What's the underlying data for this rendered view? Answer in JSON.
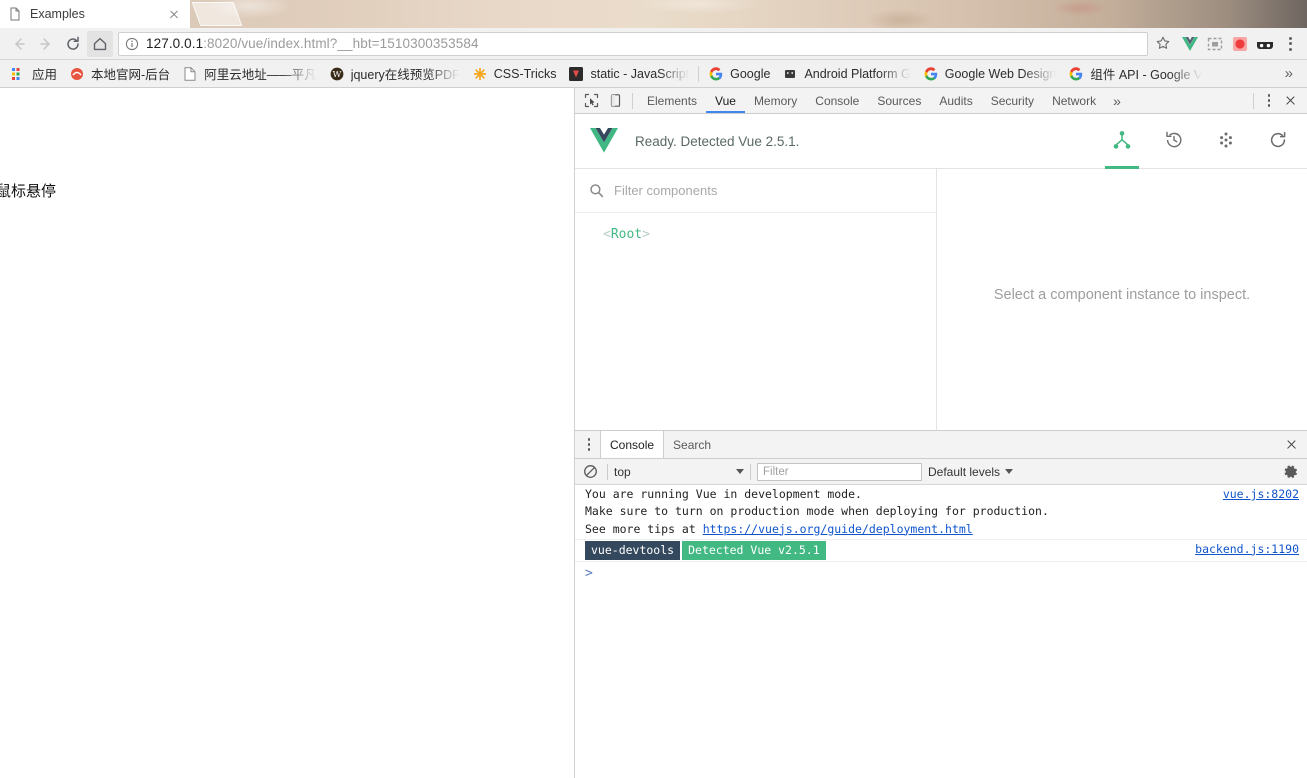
{
  "browser": {
    "tab": {
      "title": "Examples",
      "favicon": "page-icon",
      "close": "close-icon"
    },
    "nav": {
      "back": "back-arrow-icon",
      "forward": "forward-arrow-icon",
      "reload": "reload-icon",
      "home": "home-icon"
    },
    "omnibox": {
      "security_icon": "info-circle-icon",
      "url_host": "127.0.0.1",
      "url_rest": ":8020/vue/index.html?__hbt=1510300353584",
      "url_full": "127.0.0.1:8020/vue/index.html?__hbt=1510300353584",
      "bookmark_star": "star-icon"
    },
    "extensions": [
      {
        "name": "vue-devtools-extension-icon",
        "color": "#41b883"
      },
      {
        "name": "screenshot-extension-icon",
        "color": "#9e9e9e"
      },
      {
        "name": "recorder-extension-icon",
        "color": "#ef4b4b"
      },
      {
        "name": "glasses-extension-icon",
        "color": "#2b2b2b"
      }
    ],
    "menu": "chrome-menu-icon",
    "bookmarks": [
      {
        "label": "应用",
        "icon": "apps-grid-icon"
      },
      {
        "label": "本地官网-后台",
        "icon": "site-favicon"
      },
      {
        "label": "阿里云地址——平凡",
        "icon": "page-icon"
      },
      {
        "label": "jquery在线预览PDF",
        "icon": "wordpress-favicon"
      },
      {
        "label": "CSS-Tricks",
        "icon": "css-tricks-favicon"
      },
      {
        "label": "static - JavaScript",
        "icon": "dark-favicon"
      },
      {
        "label": "Google",
        "icon": "google-favicon"
      },
      {
        "label": "Android Platform G",
        "icon": "android-favicon"
      },
      {
        "label": "Google Web Design",
        "icon": "google-favicon"
      },
      {
        "label": "组件 API - Google V",
        "icon": "google-favicon"
      }
    ],
    "bookmarks_overflow": "»"
  },
  "page": {
    "text": "鼠标悬停"
  },
  "devtools": {
    "inspect_icon": "inspect-element-icon",
    "device_icon": "toggle-device-toolbar-icon",
    "tabs": [
      {
        "label": "Elements",
        "active": false
      },
      {
        "label": "Vue",
        "active": true
      },
      {
        "label": "Memory",
        "active": false
      },
      {
        "label": "Console",
        "active": false
      },
      {
        "label": "Sources",
        "active": false
      },
      {
        "label": "Audits",
        "active": false
      },
      {
        "label": "Security",
        "active": false
      },
      {
        "label": "Network",
        "active": false
      }
    ],
    "more_tabs": "»",
    "settings_menu": "devtools-kebab-icon",
    "close": "close-icon",
    "accent": "#4285f4"
  },
  "vue_panel": {
    "logo": "vue-logo-icon",
    "status": "Ready. Detected Vue 2.5.1.",
    "accent": "#42b883",
    "actions": [
      {
        "name": "component-tree-icon",
        "active": true
      },
      {
        "name": "time-travel-icon",
        "active": false
      },
      {
        "name": "events-icon",
        "active": false
      },
      {
        "name": "refresh-icon",
        "active": false
      }
    ],
    "filter": {
      "icon": "search-icon",
      "placeholder": "Filter components",
      "value": ""
    },
    "tree": [
      {
        "label": "Root",
        "open_bracket": "<",
        "close_bracket": ">"
      }
    ],
    "detail_placeholder": "Select a component instance to inspect."
  },
  "console_drawer": {
    "menu_icon": "drawer-kebab-icon",
    "tabs": [
      {
        "label": "Console",
        "active": true
      },
      {
        "label": "Search",
        "active": false
      }
    ],
    "close": "close-icon",
    "toolbar": {
      "clear_icon": "clear-console-icon",
      "context": "top",
      "filter_placeholder": "Filter",
      "filter_value": "",
      "levels": "Default levels",
      "settings_icon": "gear-icon"
    },
    "messages": [
      {
        "type": "text",
        "lines": [
          "You are running Vue in development mode.",
          "Make sure to turn on production mode when deploying for production.",
          "See more tips at "
        ],
        "link": "https://vuejs.org/guide/deployment.html",
        "source": "vue.js:8202"
      },
      {
        "type": "badges",
        "badge_dark": "vue-devtools",
        "badge_green": "Detected Vue v2.5.1",
        "source": "backend.js:1190"
      }
    ],
    "prompt": ">"
  }
}
